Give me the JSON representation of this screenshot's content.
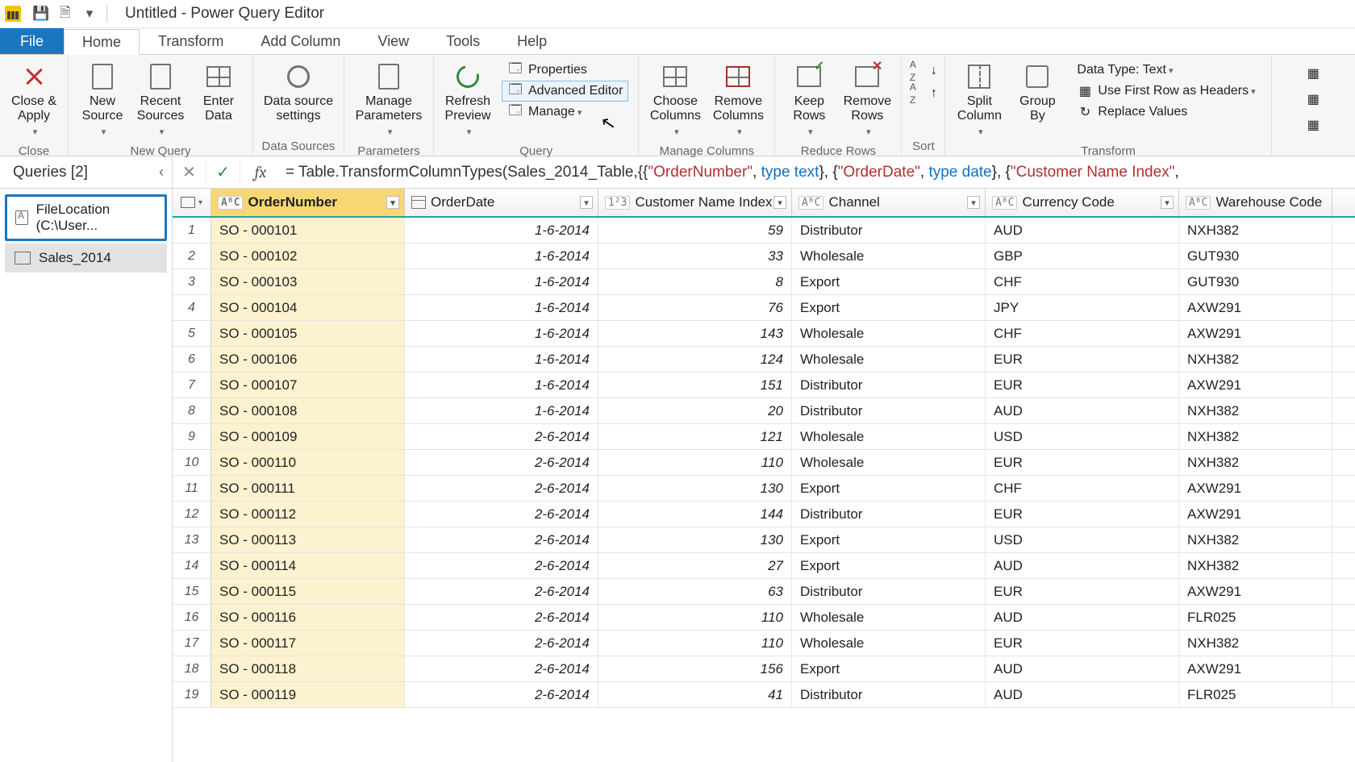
{
  "title": "Untitled - Power Query Editor",
  "menus": {
    "file": "File",
    "home": "Home",
    "transform": "Transform",
    "addcol": "Add Column",
    "view": "View",
    "tools": "Tools",
    "help": "Help"
  },
  "ribbon": {
    "close_apply": "Close &\nApply",
    "close_group": "Close",
    "new_source": "New\nSource",
    "recent_sources": "Recent\nSources",
    "enter_data": "Enter\nData",
    "new_query_group": "New Query",
    "data_source_settings": "Data source\nsettings",
    "data_sources_group": "Data Sources",
    "manage_parameters": "Manage\nParameters",
    "parameters_group": "Parameters",
    "refresh_preview": "Refresh\nPreview",
    "properties": "Properties",
    "advanced_editor": "Advanced Editor",
    "manage": "Manage",
    "query_group": "Query",
    "choose_cols": "Choose\nColumns",
    "remove_cols": "Remove\nColumns",
    "manage_cols_group": "Manage Columns",
    "keep_rows": "Keep\nRows",
    "remove_rows": "Remove\nRows",
    "reduce_rows_group": "Reduce Rows",
    "sort_group": "Sort",
    "split_column": "Split\nColumn",
    "group_by": "Group\nBy",
    "data_type": "Data Type: Text",
    "use_first_row": "Use First Row as Headers",
    "replace_values": "Replace Values",
    "transform_group": "Transform"
  },
  "queries_header": "Queries [2]",
  "queries": [
    {
      "label": "FileLocation (C:\\User..."
    },
    {
      "label": "Sales_2014"
    }
  ],
  "formula": {
    "prefix": "= Table.TransformColumnTypes(Sales_2014_Table,{{",
    "s1": "\"OrderNumber\"",
    "m1": ", ",
    "kw1": "type text",
    "m2": "}, {",
    "s2": "\"OrderDate\"",
    "m3": ", ",
    "kw2": "type date",
    "m4": "}, {",
    "s3": "\"Customer Name Index\"",
    "m5": ","
  },
  "columns": {
    "order": "OrderNumber",
    "date": "OrderDate",
    "idx": "Customer Name Index",
    "chan": "Channel",
    "curr": "Currency Code",
    "wh": "Warehouse Code",
    "type_text": "AᴮC",
    "type_num": "1²3"
  },
  "rows": [
    {
      "n": 1,
      "order": "SO - 000101",
      "date": "1-6-2014",
      "idx": 59,
      "chan": "Distributor",
      "curr": "AUD",
      "wh": "NXH382"
    },
    {
      "n": 2,
      "order": "SO - 000102",
      "date": "1-6-2014",
      "idx": 33,
      "chan": "Wholesale",
      "curr": "GBP",
      "wh": "GUT930"
    },
    {
      "n": 3,
      "order": "SO - 000103",
      "date": "1-6-2014",
      "idx": 8,
      "chan": "Export",
      "curr": "CHF",
      "wh": "GUT930"
    },
    {
      "n": 4,
      "order": "SO - 000104",
      "date": "1-6-2014",
      "idx": 76,
      "chan": "Export",
      "curr": "JPY",
      "wh": "AXW291"
    },
    {
      "n": 5,
      "order": "SO - 000105",
      "date": "1-6-2014",
      "idx": 143,
      "chan": "Wholesale",
      "curr": "CHF",
      "wh": "AXW291"
    },
    {
      "n": 6,
      "order": "SO - 000106",
      "date": "1-6-2014",
      "idx": 124,
      "chan": "Wholesale",
      "curr": "EUR",
      "wh": "NXH382"
    },
    {
      "n": 7,
      "order": "SO - 000107",
      "date": "1-6-2014",
      "idx": 151,
      "chan": "Distributor",
      "curr": "EUR",
      "wh": "AXW291"
    },
    {
      "n": 8,
      "order": "SO - 000108",
      "date": "1-6-2014",
      "idx": 20,
      "chan": "Distributor",
      "curr": "AUD",
      "wh": "NXH382"
    },
    {
      "n": 9,
      "order": "SO - 000109",
      "date": "2-6-2014",
      "idx": 121,
      "chan": "Wholesale",
      "curr": "USD",
      "wh": "NXH382"
    },
    {
      "n": 10,
      "order": "SO - 000110",
      "date": "2-6-2014",
      "idx": 110,
      "chan": "Wholesale",
      "curr": "EUR",
      "wh": "NXH382"
    },
    {
      "n": 11,
      "order": "SO - 000111",
      "date": "2-6-2014",
      "idx": 130,
      "chan": "Export",
      "curr": "CHF",
      "wh": "AXW291"
    },
    {
      "n": 12,
      "order": "SO - 000112",
      "date": "2-6-2014",
      "idx": 144,
      "chan": "Distributor",
      "curr": "EUR",
      "wh": "AXW291"
    },
    {
      "n": 13,
      "order": "SO - 000113",
      "date": "2-6-2014",
      "idx": 130,
      "chan": "Export",
      "curr": "USD",
      "wh": "NXH382"
    },
    {
      "n": 14,
      "order": "SO - 000114",
      "date": "2-6-2014",
      "idx": 27,
      "chan": "Export",
      "curr": "AUD",
      "wh": "NXH382"
    },
    {
      "n": 15,
      "order": "SO - 000115",
      "date": "2-6-2014",
      "idx": 63,
      "chan": "Distributor",
      "curr": "EUR",
      "wh": "AXW291"
    },
    {
      "n": 16,
      "order": "SO - 000116",
      "date": "2-6-2014",
      "idx": 110,
      "chan": "Wholesale",
      "curr": "AUD",
      "wh": "FLR025"
    },
    {
      "n": 17,
      "order": "SO - 000117",
      "date": "2-6-2014",
      "idx": 110,
      "chan": "Wholesale",
      "curr": "EUR",
      "wh": "NXH382"
    },
    {
      "n": 18,
      "order": "SO - 000118",
      "date": "2-6-2014",
      "idx": 156,
      "chan": "Export",
      "curr": "AUD",
      "wh": "AXW291"
    },
    {
      "n": 19,
      "order": "SO - 000119",
      "date": "2-6-2014",
      "idx": 41,
      "chan": "Distributor",
      "curr": "AUD",
      "wh": "FLR025"
    }
  ]
}
